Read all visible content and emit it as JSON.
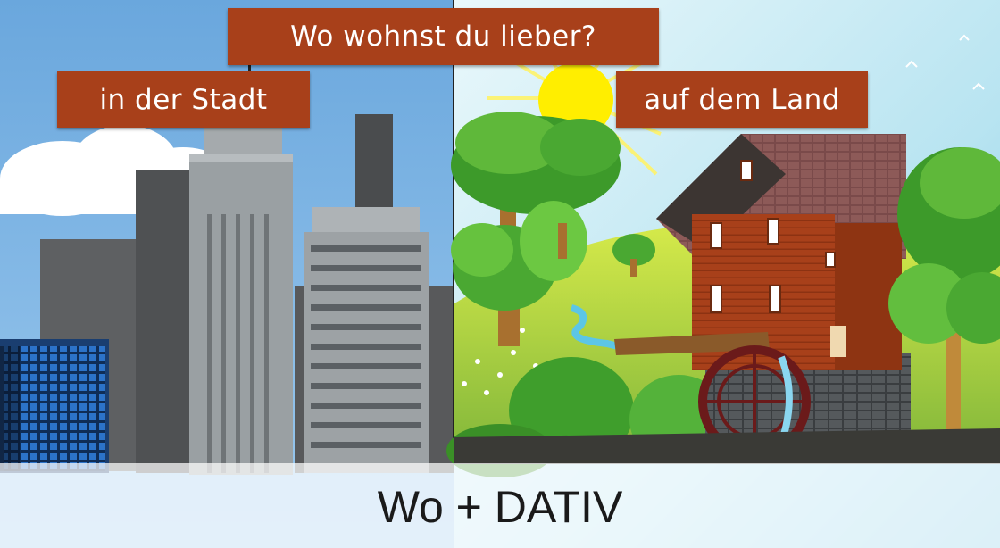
{
  "question": "Wo wohnst du lieber?",
  "option_city": "in der Stadt",
  "option_country": "auf dem Land",
  "caption": "Wo + DATIV",
  "colors": {
    "sign": "#a8401a",
    "sky_left": "#7fb6e3",
    "sky_right": "#bfe6f2",
    "sun": "#ffee00",
    "grass": "#9acb3c",
    "mill_wall": "#a8401a",
    "roof": "#7a4a4a"
  },
  "icons": [
    "city-skyline-illustration",
    "countryside-mill-illustration",
    "sun-icon",
    "cloud-icon",
    "water-wheel-icon",
    "tree-icon",
    "bird-icon"
  ]
}
